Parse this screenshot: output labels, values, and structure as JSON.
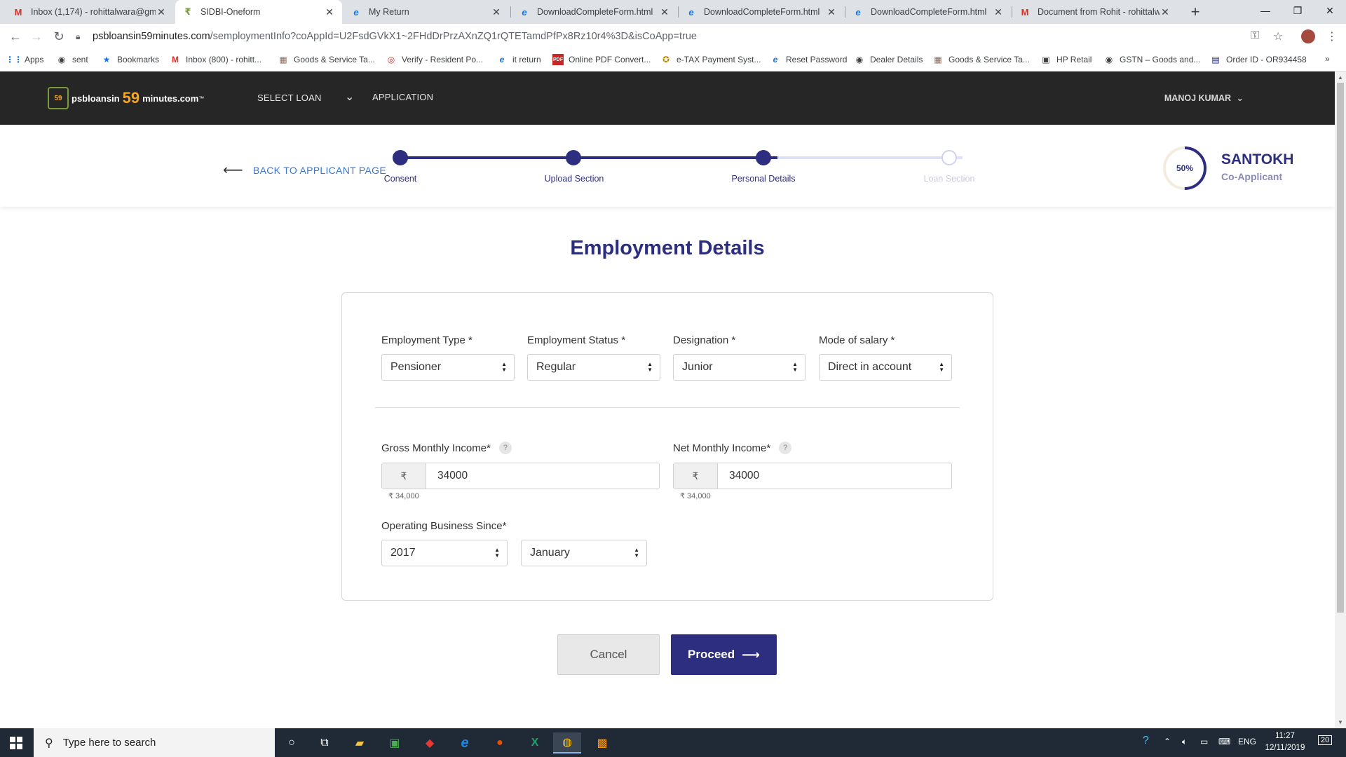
{
  "browser": {
    "tabs": [
      {
        "title": "Inbox (1,174) - rohittalwara@gm",
        "icon": "gmail-icon",
        "active": false
      },
      {
        "title": "SIDBI-Oneform",
        "icon": "site-icon",
        "active": true
      },
      {
        "title": "My Return",
        "icon": "ie-icon",
        "active": false
      },
      {
        "title": "DownloadCompleteForm.html",
        "icon": "ie-icon",
        "active": false
      },
      {
        "title": "DownloadCompleteForm.html",
        "icon": "ie-icon",
        "active": false
      },
      {
        "title": "DownloadCompleteForm.html",
        "icon": "ie-icon",
        "active": false
      },
      {
        "title": "Document from Rohit - rohittalw",
        "icon": "gmail-icon",
        "active": false
      }
    ],
    "url_domain": "psbloansin59minutes.com",
    "url_path": "/semploymentInfo?coAppId=U2FsdGVkX1~2FHdDrPrzAXnZQ1rQTETamdPfPx8Rz10r4%3D&isCoApp=true",
    "bookmarks": [
      "Apps",
      "sent",
      "Bookmarks",
      "Inbox (800) - rohitt...",
      "Goods & Service Ta...",
      "Verify - Resident Po...",
      "it return",
      "Online PDF Convert...",
      "e-TAX Payment Syst...",
      "Reset Password",
      "Dealer Details",
      "Goods & Service Ta...",
      "HP Retail",
      "GSTN – Goods and...",
      "Order ID - OR934458"
    ],
    "bookmarks_more": "»"
  },
  "header": {
    "logo_part1": "psbloansin",
    "logo_part2": "59",
    "logo_part3": "minutes.com",
    "logo_tm": "™",
    "logo_badge": "59",
    "nav_select_loan": "SELECT LOAN",
    "nav_application": "APPLICATION",
    "user_name": "MANOJ KUMAR"
  },
  "progress": {
    "back_label": "BACK TO APPLICANT PAGE",
    "steps": [
      {
        "label": "Consent",
        "done": true
      },
      {
        "label": "Upload Section",
        "done": true
      },
      {
        "label": "Personal Details",
        "done": true
      },
      {
        "label": "Loan Section",
        "done": false
      }
    ],
    "percent": 0.5,
    "percent_label": "50%",
    "applicant_name": "SANTOKH",
    "applicant_role": "Co-Applicant"
  },
  "form": {
    "title": "Employment Details",
    "employment_type": {
      "label": "Employment Type *",
      "value": "Pensioner"
    },
    "employment_status": {
      "label": "Employment Status *",
      "value": "Regular"
    },
    "designation": {
      "label": "Designation *",
      "value": "Junior"
    },
    "mode_of_salary": {
      "label": "Mode of salary *",
      "value": "Direct in account"
    },
    "gross_income": {
      "label": "Gross Monthly Income*",
      "currency": "₹",
      "value": "34000",
      "formatted": "₹ 34,000"
    },
    "net_income": {
      "label": "Net Monthly Income*",
      "currency": "₹",
      "value": "34000",
      "formatted": "₹ 34,000"
    },
    "operating_since": {
      "label": "Operating Business Since*",
      "year": "2017",
      "month": "January"
    },
    "help_glyph": "?"
  },
  "actions": {
    "cancel": "Cancel",
    "proceed": "Proceed"
  },
  "taskbar": {
    "search_placeholder": "Type here to search",
    "language": "ENG",
    "time": "11:27",
    "date": "12/11/2019",
    "notifications": "20"
  },
  "colors": {
    "primary": "#2d2e80",
    "header_bg": "#262626",
    "accent_orange": "#f5a623",
    "link": "#3c77c9"
  }
}
